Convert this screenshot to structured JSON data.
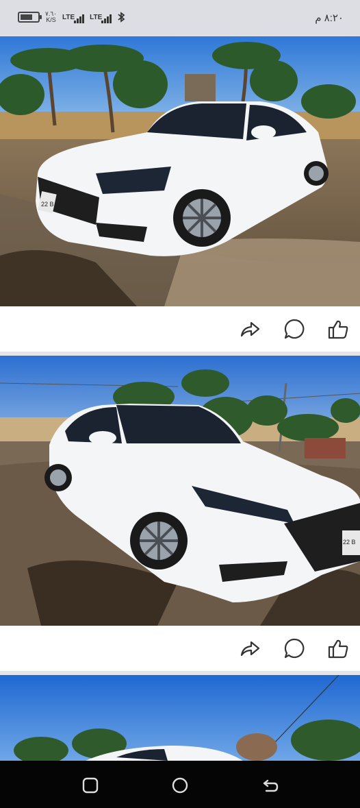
{
  "status_bar": {
    "time": "٨:٢٠ م",
    "battery_level": 0.7,
    "net_speed_value": "٧.٦٠",
    "net_speed_unit": "K/S",
    "sim1_label": "LTE",
    "sim2_label": "LTE",
    "bluetooth_icon": "bluetooth-icon"
  },
  "feed": {
    "posts": [
      {
        "photo_alt": "White sedan on wet ground with palm trees",
        "plate_text": "22 B",
        "actions": [
          {
            "name": "share",
            "icon": "share-arrow-icon"
          },
          {
            "name": "comment",
            "icon": "comment-bubble-icon"
          },
          {
            "name": "like",
            "icon": "thumbs-up-icon"
          }
        ]
      },
      {
        "photo_alt": "White sedan front three-quarter view on wet ground",
        "plate_text": "22 B",
        "actions": [
          {
            "name": "share",
            "icon": "share-arrow-icon"
          },
          {
            "name": "comment",
            "icon": "comment-bubble-icon"
          },
          {
            "name": "like",
            "icon": "thumbs-up-icon"
          }
        ]
      },
      {
        "photo_alt": "White car with palm trees and sky, partially visible"
      }
    ]
  },
  "nav_bar": {
    "items": [
      "recent-apps-icon",
      "home-icon",
      "back-icon"
    ]
  },
  "colors": {
    "accent_icon": "#333333",
    "divider": "#e4e5e9",
    "nav_background": "#050505"
  }
}
